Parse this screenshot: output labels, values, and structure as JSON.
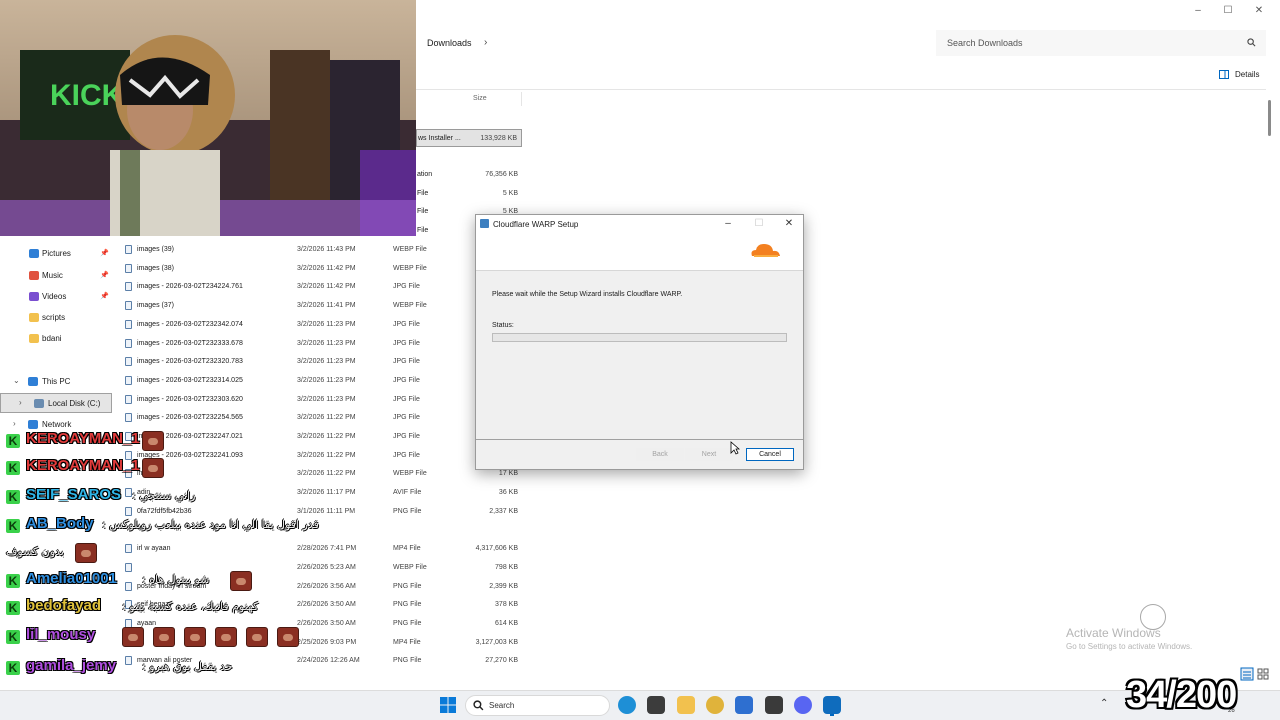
{
  "explorer": {
    "breadcrumb": "Downloads",
    "search_placeholder": "Search Downloads",
    "details_label": "Details",
    "size_column": "Size",
    "partial_rows": [
      {
        "name": "ws Installer ...",
        "size": "133,928 KB",
        "selected": true
      },
      {
        "name": "ation",
        "size": "76,356 KB"
      },
      {
        "name": "File",
        "size": "5 KB"
      },
      {
        "name": "File",
        "size": "5 KB"
      },
      {
        "name": "File",
        "size": ""
      }
    ],
    "files": [
      {
        "name": "images (39)",
        "date": "3/2/2026 11:43 PM",
        "type": "WEBP File",
        "size": ""
      },
      {
        "name": "images (38)",
        "date": "3/2/2026 11:42 PM",
        "type": "WEBP File",
        "size": ""
      },
      {
        "name": "images - 2026-03-02T234224.761",
        "date": "3/2/2026 11:42 PM",
        "type": "JPG File",
        "size": ""
      },
      {
        "name": "images (37)",
        "date": "3/2/2026 11:41 PM",
        "type": "WEBP File",
        "size": ""
      },
      {
        "name": "images - 2026-03-02T232342.074",
        "date": "3/2/2026 11:23 PM",
        "type": "JPG File",
        "size": ""
      },
      {
        "name": "images - 2026-03-02T232333.678",
        "date": "3/2/2026 11:23 PM",
        "type": "JPG File",
        "size": ""
      },
      {
        "name": "images - 2026-03-02T232320.783",
        "date": "3/2/2026 11:23 PM",
        "type": "JPG File",
        "size": ""
      },
      {
        "name": "images - 2026-03-02T232314.025",
        "date": "3/2/2026 11:23 PM",
        "type": "JPG File",
        "size": ""
      },
      {
        "name": "images - 2026-03-02T232303.620",
        "date": "3/2/2026 11:23 PM",
        "type": "JPG File",
        "size": ""
      },
      {
        "name": "images - 2026-03-02T232254.565",
        "date": "3/2/2026 11:22 PM",
        "type": "JPG File",
        "size": ""
      },
      {
        "name": "images - 2026-03-02T232247.021",
        "date": "3/2/2026 11:22 PM",
        "type": "JPG File",
        "size": ""
      },
      {
        "name": "images - 2026-03-02T232241.093",
        "date": "3/2/2026 11:22 PM",
        "type": "JPG File",
        "size": ""
      },
      {
        "name": "images",
        "date": "3/2/2026 11:22 PM",
        "type": "WEBP File",
        "size": "17 KB"
      },
      {
        "name": "adin",
        "date": "3/2/2026 11:17 PM",
        "type": "AVIF File",
        "size": "36 KB"
      },
      {
        "name": "0fa72fdf5fb42b36",
        "date": "3/1/2026 11:11 PM",
        "type": "PNG File",
        "size": "2,337 KB"
      },
      {
        "name": "",
        "date": "",
        "type": "",
        "size": ""
      },
      {
        "name": "irl w ayaan",
        "date": "2/28/2026 7:41 PM",
        "type": "MP4 File",
        "size": "4,317,606 KB"
      },
      {
        "name": "",
        "date": "2/26/2026 5:23 AM",
        "type": "WEBP File",
        "size": "798 KB"
      },
      {
        "name": "poster friday irl stream",
        "date": "2/26/2026 3:56 AM",
        "type": "PNG File",
        "size": "2,399 KB"
      },
      {
        "name": "seif hegazy",
        "date": "2/26/2026 3:50 AM",
        "type": "PNG File",
        "size": "378 KB"
      },
      {
        "name": "ayaan",
        "date": "2/26/2026 3:50 AM",
        "type": "PNG File",
        "size": "614 KB"
      },
      {
        "name": "",
        "date": "2/25/2026 9:03 PM",
        "type": "MP4 File",
        "size": "3,127,003 KB"
      },
      {
        "name": "marwan ali poster",
        "date": "2/24/2026 12:26 AM",
        "type": "PNG File",
        "size": "27,270 KB"
      }
    ],
    "nav": [
      {
        "label": "Pictures",
        "icon": "pictures-icon",
        "color": "#2f7fd6",
        "pinned": true
      },
      {
        "label": "Music",
        "icon": "music-icon",
        "color": "#e0523f",
        "pinned": true
      },
      {
        "label": "Videos",
        "icon": "videos-icon",
        "color": "#7a4fd0",
        "pinned": true
      },
      {
        "label": "scripts",
        "icon": "folder-icon",
        "color": "#f2c14e",
        "pinned": false
      },
      {
        "label": "bdani",
        "icon": "folder-icon",
        "color": "#f2c14e",
        "pinned": false
      },
      {
        "label": "This PC",
        "icon": "pc-icon",
        "color": "#2f7fd6",
        "pinned": false
      },
      {
        "label": "Local Disk (C:)",
        "icon": "drive-icon",
        "color": "#6a8cb0",
        "pinned": false
      },
      {
        "label": "Network",
        "icon": "network-icon",
        "color": "#2f7fd6",
        "pinned": false
      }
    ],
    "activate_title": "Activate Windows",
    "activate_sub": "Go to Settings to activate Windows."
  },
  "dialog": {
    "title": "Cloudflare WARP Setup",
    "message": "Please wait while the Setup Wizard installs Cloudflare WARP.",
    "status_label": "Status:",
    "progress": 0,
    "back_label": "Back",
    "next_label": "Next",
    "cancel_label": "Cancel",
    "brand_color": "#f38020"
  },
  "chat": [
    {
      "user": "KEROAYMAN_1",
      "color": "#e23b3b",
      "message": "",
      "emotes": 1
    },
    {
      "user": "KEROAYMAN_1",
      "color": "#e23b3b",
      "message": "",
      "emotes": 1
    },
    {
      "user": "SEIF_SAROS",
      "color": "#2fb6e8",
      "message": "راني سنتجي",
      "emotes": 0
    },
    {
      "user": "AB_Body",
      "color": "#2f8fe0",
      "message": "قدر اقول يقا الي انا مود عنده بيلعب روبلوكس",
      "emotes": 0
    },
    {
      "user": "",
      "color": "#ffffff",
      "message": "بدون كسوف",
      "emotes": 1
    },
    {
      "user": "Amelia01001",
      "color": "#2f8fe0",
      "message": "شو بيتول هاه",
      "emotes": 1
    },
    {
      "user": "bedofayad",
      "color": "#e0c23b",
      "message": "كهنوم فاتيك، عنده كسبة بيتو",
      "emotes": 0
    },
    {
      "user": "lil_mousy",
      "color": "#b04fe0",
      "message": "",
      "emotes": 6
    },
    {
      "user": "gamila_jemy",
      "color": "#b04fe0",
      "message": "حد يقفل بوق هيرو",
      "emotes": 0
    }
  ],
  "taskbar": {
    "search_placeholder": "Search",
    "apps": [
      "edge-icon",
      "store-icon",
      "files-icon",
      "chrome-icon",
      "mail-icon",
      "github-icon",
      "discord-icon",
      "outlook-icon"
    ],
    "date_fragment": "26"
  },
  "overlay": {
    "counter": "34/200"
  }
}
